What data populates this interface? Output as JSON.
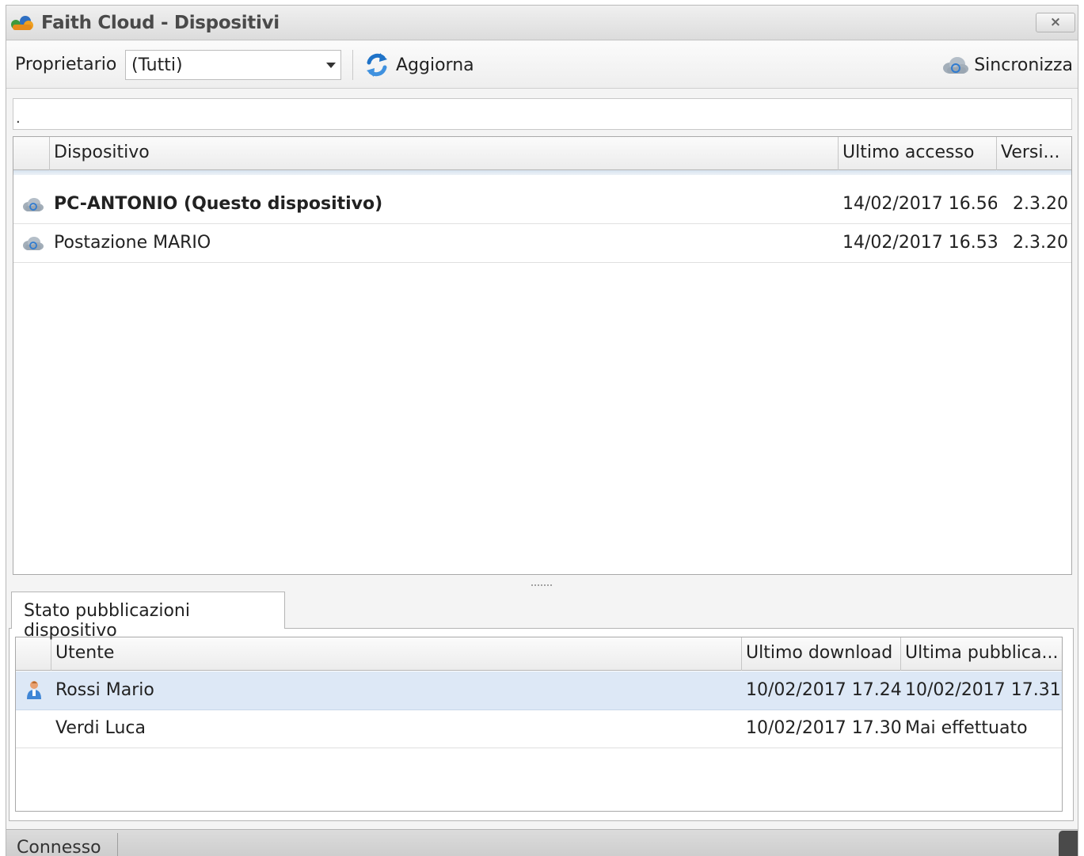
{
  "window": {
    "title": "Faith Cloud - Dispositivi",
    "close_label": "×"
  },
  "toolbar": {
    "owner_label": "Proprietario",
    "owner_value": "(Tutti)",
    "refresh_label": "Aggiorna",
    "sync_label": "Sincronizza"
  },
  "filter": {
    "value": "."
  },
  "devices": {
    "columns": [
      "Dispositivo",
      "Ultimo accesso",
      "Versi..."
    ],
    "rows": [
      {
        "name": "PC-ANTONIO (Questo dispositivo)",
        "last_access": "14/02/2017 16.56",
        "version": "2.3.20",
        "icon": "cloud-sync-icon",
        "bold": true
      },
      {
        "name": "Postazione MARIO",
        "last_access": "14/02/2017 16.53",
        "version": "2.3.20",
        "icon": "cloud-sync-icon",
        "bold": false
      }
    ]
  },
  "publications": {
    "tab_label": "Stato pubblicazioni dispositivo",
    "columns": [
      "Utente",
      "Ultimo download",
      "Ultima pubblica..."
    ],
    "rows": [
      {
        "user": "Rossi Mario",
        "last_download": "10/02/2017 17.24",
        "last_publication": "10/02/2017 17.31",
        "icon": "user-icon",
        "selected": true
      },
      {
        "user": "Verdi Luca",
        "last_download": "10/02/2017 17.30",
        "last_publication": "Mai effettuato",
        "icon": "",
        "selected": false
      }
    ]
  },
  "status": {
    "text": "Connesso"
  },
  "colors": {
    "selection": "#dde8f6",
    "refresh_blue": "#1f73c8",
    "cloud_gray": "#8c9aa8"
  }
}
